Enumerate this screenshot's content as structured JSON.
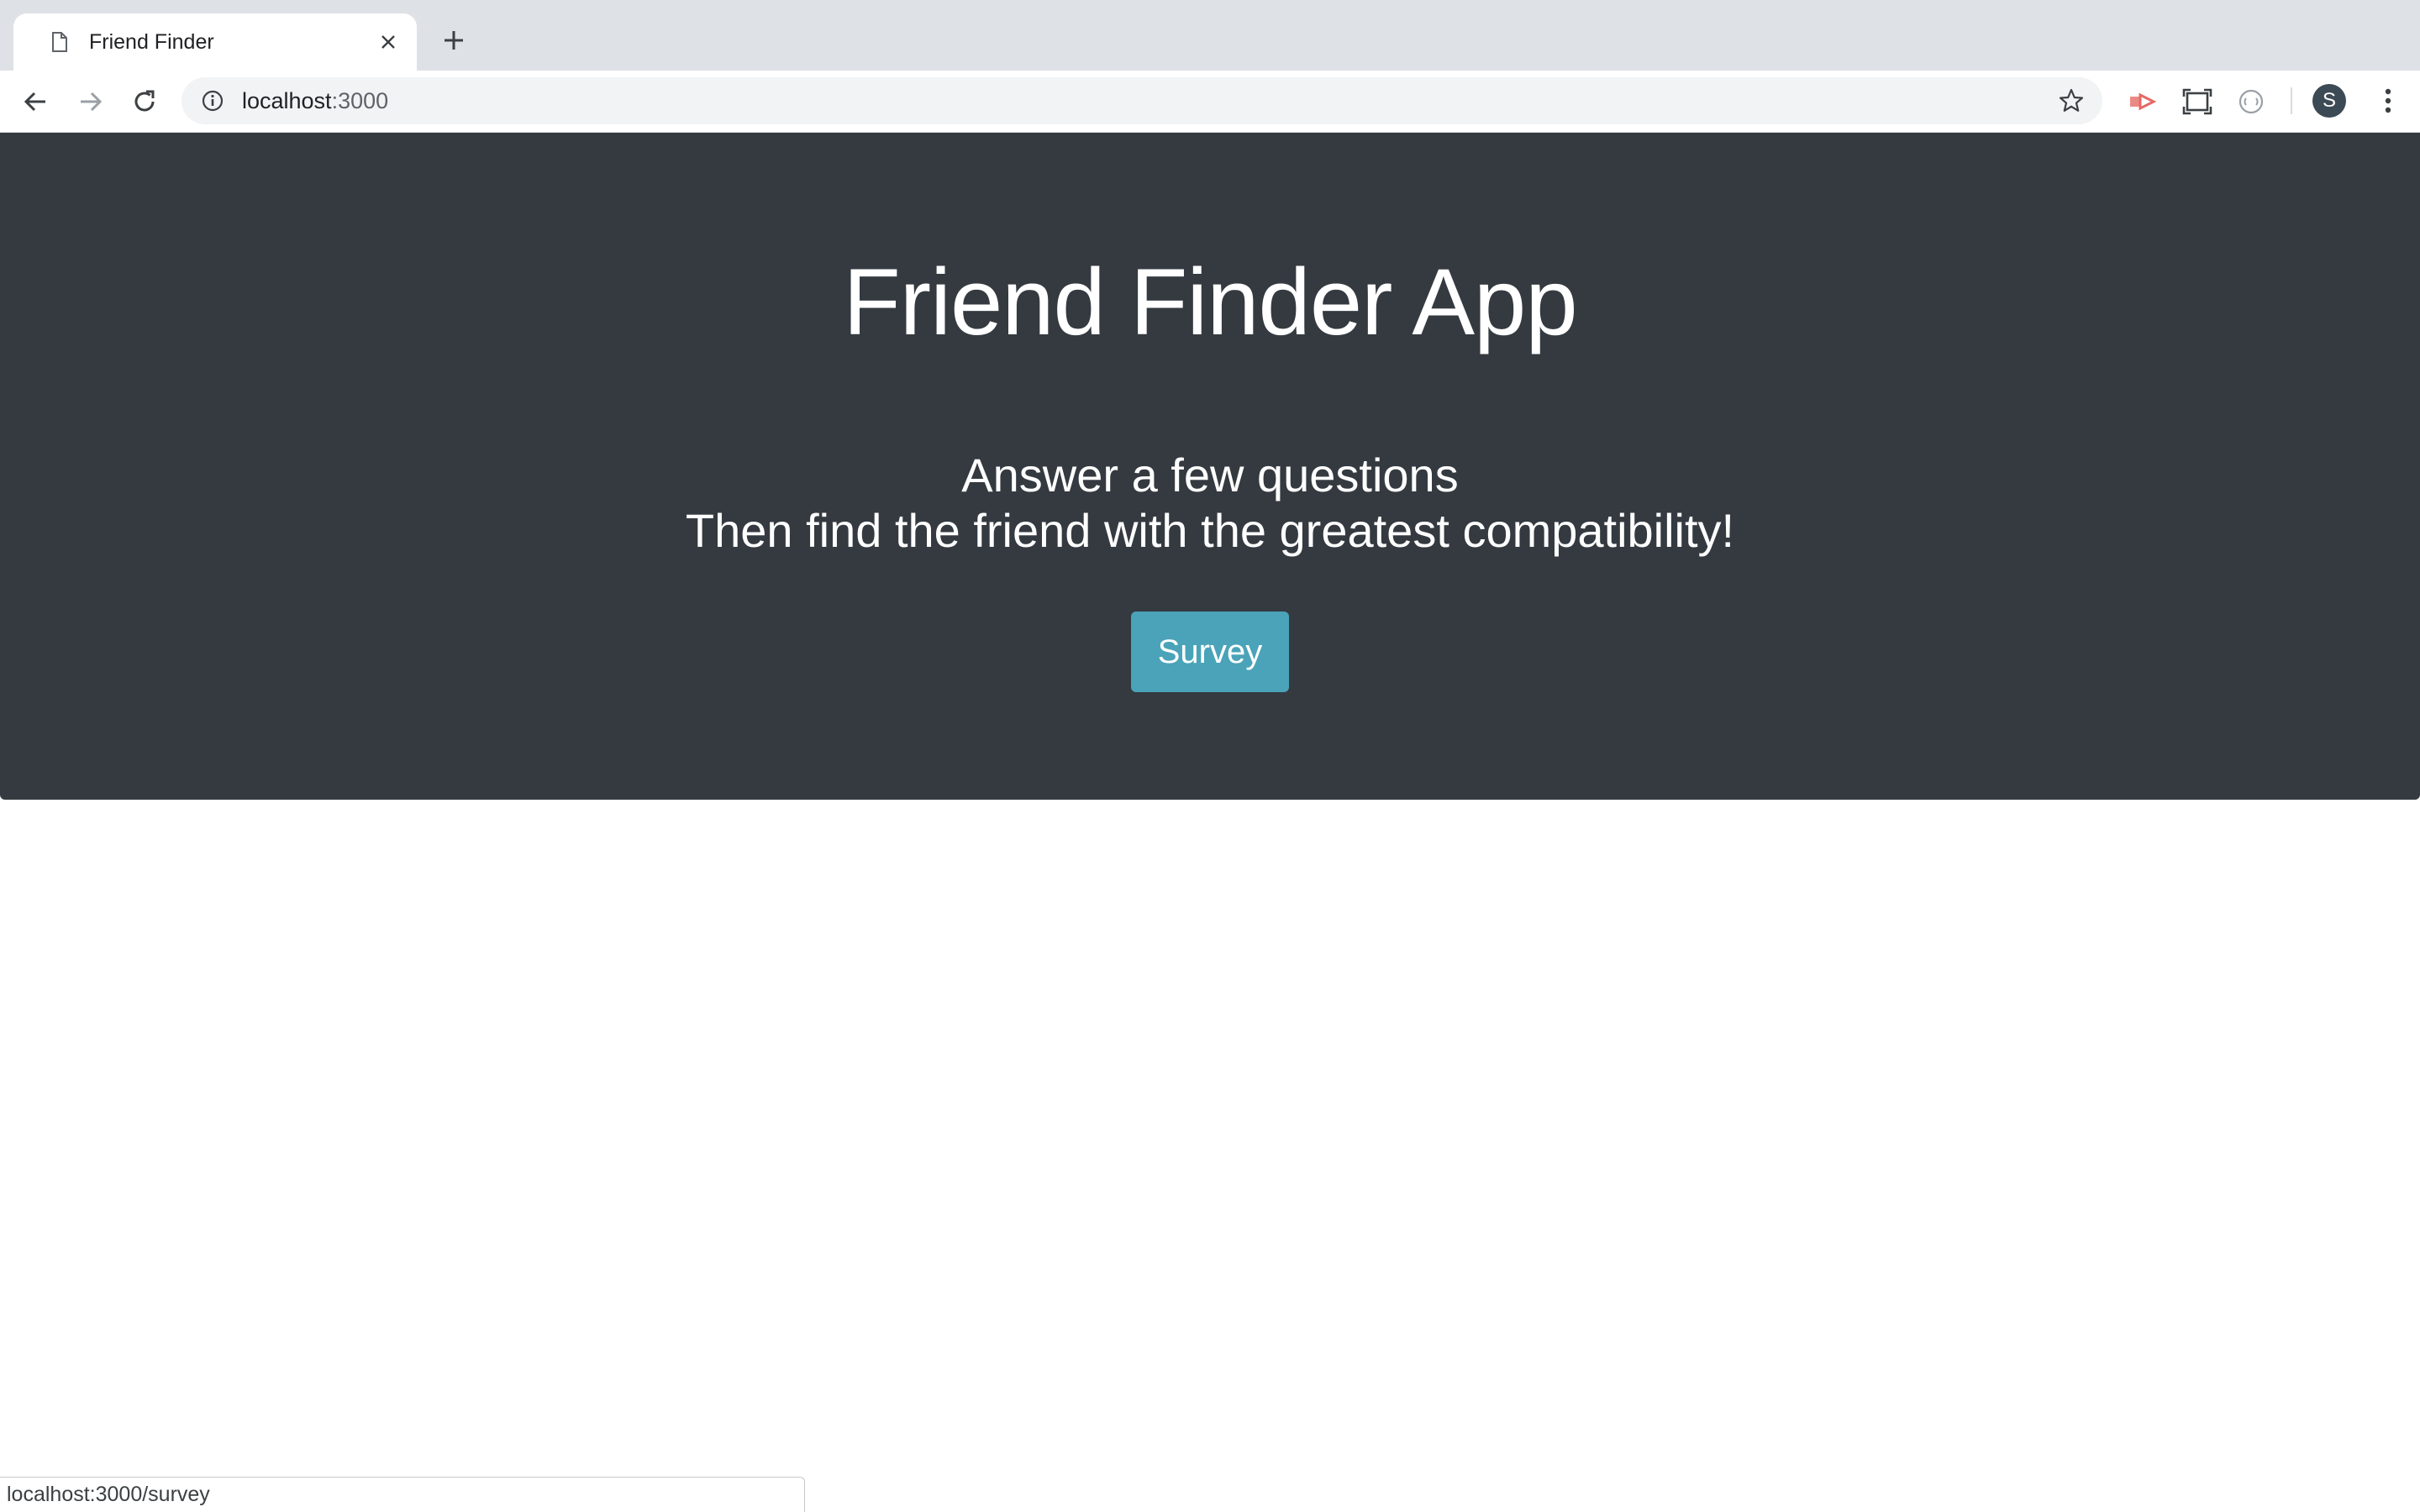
{
  "browser": {
    "tab": {
      "title": "Friend Finder",
      "icon": "page-icon",
      "close_icon": "close-icon"
    },
    "new_tab_icon": "plus-icon",
    "nav": {
      "back_icon": "arrow-left-icon",
      "forward_icon": "arrow-right-icon",
      "reload_icon": "reload-icon"
    },
    "omnibox": {
      "info_icon": "info-icon",
      "url_host": "localhost",
      "url_port": ":3000",
      "bookmark_icon": "star-icon"
    },
    "extensions": [
      "red-extension-icon",
      "screenshot-extension-icon",
      "loading-extension-icon"
    ],
    "profile_initial": "S",
    "menu_icon": "vertical-dots-icon",
    "status_url": "localhost:3000/survey"
  },
  "page": {
    "title": "Friend Finder App",
    "lead_line_1": "Answer a few questions",
    "lead_line_2": "Then find the friend with the greatest compatibility!",
    "survey_button": "Survey"
  },
  "colors": {
    "jumbotron_bg": "#343a40",
    "button_bg": "#4aa3b8",
    "tabstrip_bg": "#dee1e6"
  }
}
